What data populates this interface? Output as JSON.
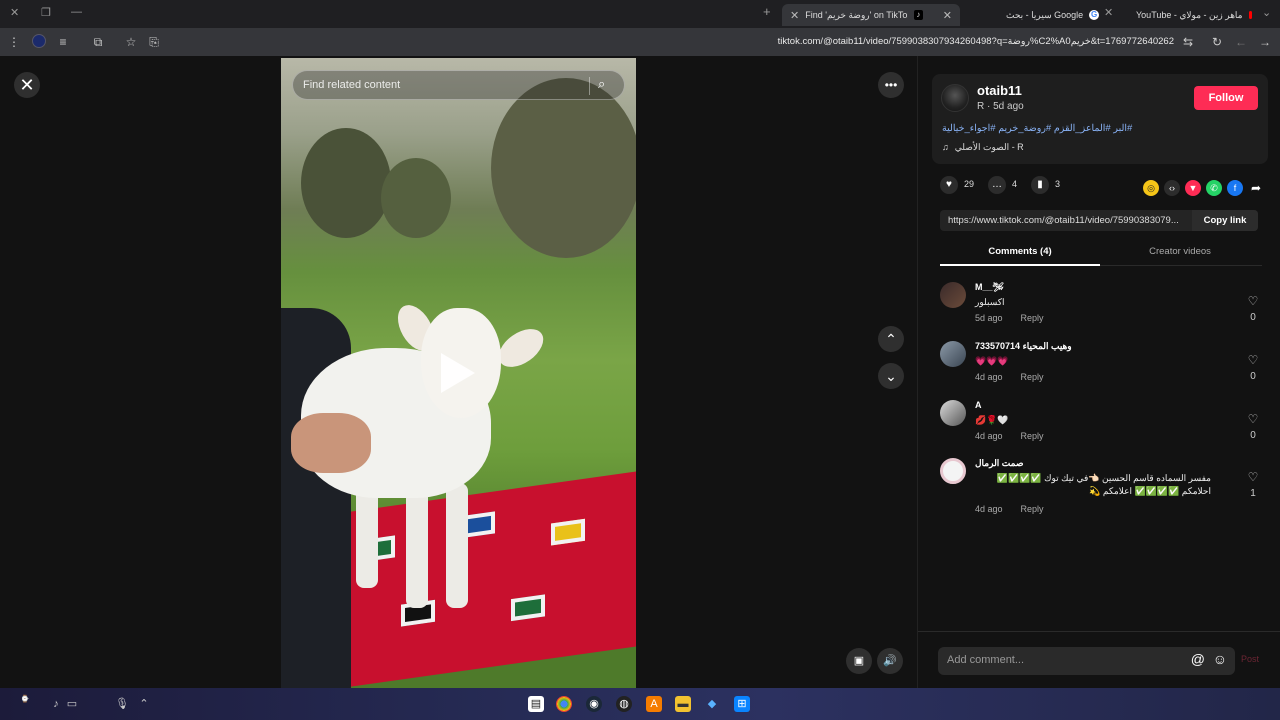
{
  "browser": {
    "tabs": [
      {
        "title": "Find 'روضة خريم' on TikTok | Ti",
        "active": true
      },
      {
        "title": "سيريا - بحث Google",
        "active": false
      },
      {
        "title": "YouTube - ماهر زين - مولاي",
        "active": false
      }
    ],
    "url": "tiktok.com/@otaib11/video/7599038307934260498?q=روضة%C2%A0خريم&t=1769772640262",
    "new_tab_label": "+"
  },
  "video": {
    "search_placeholder": "Find related content"
  },
  "author": {
    "username": "otaib11",
    "subline": "R · 5d ago",
    "follow_label": "Follow",
    "hashtags": "#البر #الماعز_القزم #روضة_خريم #اجواء_خيالية",
    "music": "الصوت الأصلي - R"
  },
  "stats": {
    "likes": "29",
    "comments": "4",
    "saves": "3"
  },
  "share": {
    "link": "https://www.tiktok.com/@otaib11/video/75990383079...",
    "copy_label": "Copy link"
  },
  "tabs": {
    "comments": "Comments (4)",
    "creator": "Creator videos"
  },
  "comments": [
    {
      "name": "M__🛩",
      "text": "اكسبلور",
      "time": "5d ago",
      "reply": "Reply",
      "likes": "0"
    },
    {
      "name": "وهيب المحياء 733570714",
      "text": "💗💗💗",
      "time": "4d ago",
      "reply": "Reply",
      "likes": "0"
    },
    {
      "name": "A",
      "text": "💋🌹🤍",
      "time": "4d ago",
      "reply": "Reply",
      "likes": "0"
    },
    {
      "name": "صمت الرمال",
      "text": "مفسر السماده قاسم الحسين 👈🏻في تيك توك ✅✅✅✅ احلامكم ✅✅✅✅ اعلامكم 💫",
      "time": "4d ago",
      "reply": "Reply",
      "likes": "1"
    }
  ],
  "composer": {
    "placeholder": "Add comment...",
    "post_label": "Post"
  },
  "colors": {
    "accent": "#fe2c55",
    "link": "#8ab4f8"
  }
}
